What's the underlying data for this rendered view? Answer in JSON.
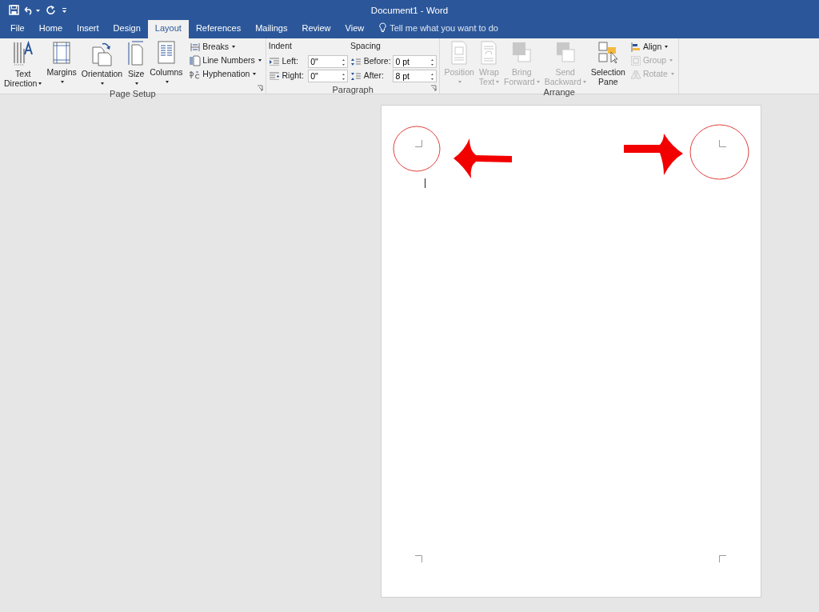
{
  "title_bar": {
    "title": "Document1 - Word"
  },
  "tabs": [
    {
      "label": "File",
      "selected": false
    },
    {
      "label": "Home",
      "selected": false
    },
    {
      "label": "Insert",
      "selected": false
    },
    {
      "label": "Design",
      "selected": false
    },
    {
      "label": "Layout",
      "selected": true
    },
    {
      "label": "References",
      "selected": false
    },
    {
      "label": "Mailings",
      "selected": false
    },
    {
      "label": "Review",
      "selected": false
    },
    {
      "label": "View",
      "selected": false
    }
  ],
  "tell_me": {
    "placeholder": "Tell me what you want to do"
  },
  "page_setup": {
    "label": "Page Setup",
    "large_buttons": [
      {
        "kind": "text-direction",
        "lines": [
          "Text",
          "Direction"
        ],
        "dropdown": true
      },
      {
        "kind": "margins",
        "lines": [
          "Margins"
        ],
        "dropdown": true
      },
      {
        "kind": "orientation",
        "lines": [
          "Orientation"
        ],
        "dropdown": true
      },
      {
        "kind": "size",
        "lines": [
          "Size"
        ],
        "dropdown": true
      },
      {
        "kind": "columns",
        "lines": [
          "Columns"
        ],
        "dropdown": true
      }
    ],
    "small_buttons": [
      {
        "kind": "breaks",
        "label": "Breaks",
        "dropdown": true
      },
      {
        "kind": "line-numbers",
        "label": "Line Numbers",
        "dropdown": true
      },
      {
        "kind": "hyphenation",
        "label": "Hyphenation",
        "dropdown": true
      }
    ]
  },
  "paragraph": {
    "label": "Paragraph",
    "indent_label": "Indent",
    "spacing_label": "Spacing",
    "indent": [
      {
        "kind": "left",
        "label": "Left:",
        "value": "0\""
      },
      {
        "kind": "right",
        "label": "Right:",
        "value": "0\""
      }
    ],
    "spacing": [
      {
        "kind": "before",
        "label": "Before:",
        "value": "0 pt"
      },
      {
        "kind": "after",
        "label": "After:",
        "value": "8 pt"
      }
    ]
  },
  "arrange": {
    "label": "Arrange",
    "large_buttons": [
      {
        "kind": "position",
        "lines": [
          "Position"
        ],
        "dropdown": true,
        "disabled": true
      },
      {
        "kind": "wrap",
        "lines": [
          "Wrap",
          "Text"
        ],
        "dropdown": true,
        "disabled": true
      },
      {
        "kind": "forward",
        "lines": [
          "Bring",
          "Forward"
        ],
        "dropdown": true,
        "disabled": true
      },
      {
        "kind": "backward",
        "lines": [
          "Send",
          "Backward"
        ],
        "dropdown": true,
        "disabled": true
      },
      {
        "kind": "selection",
        "lines": [
          "Selection",
          "Pane"
        ],
        "dropdown": false,
        "disabled": false
      }
    ],
    "small_buttons": [
      {
        "kind": "align",
        "label": "Align",
        "dropdown": true,
        "disabled": false
      },
      {
        "kind": "group",
        "label": "Group",
        "dropdown": true,
        "disabled": true
      },
      {
        "kind": "rotate",
        "label": "Rotate",
        "dropdown": true,
        "disabled": true
      }
    ]
  }
}
